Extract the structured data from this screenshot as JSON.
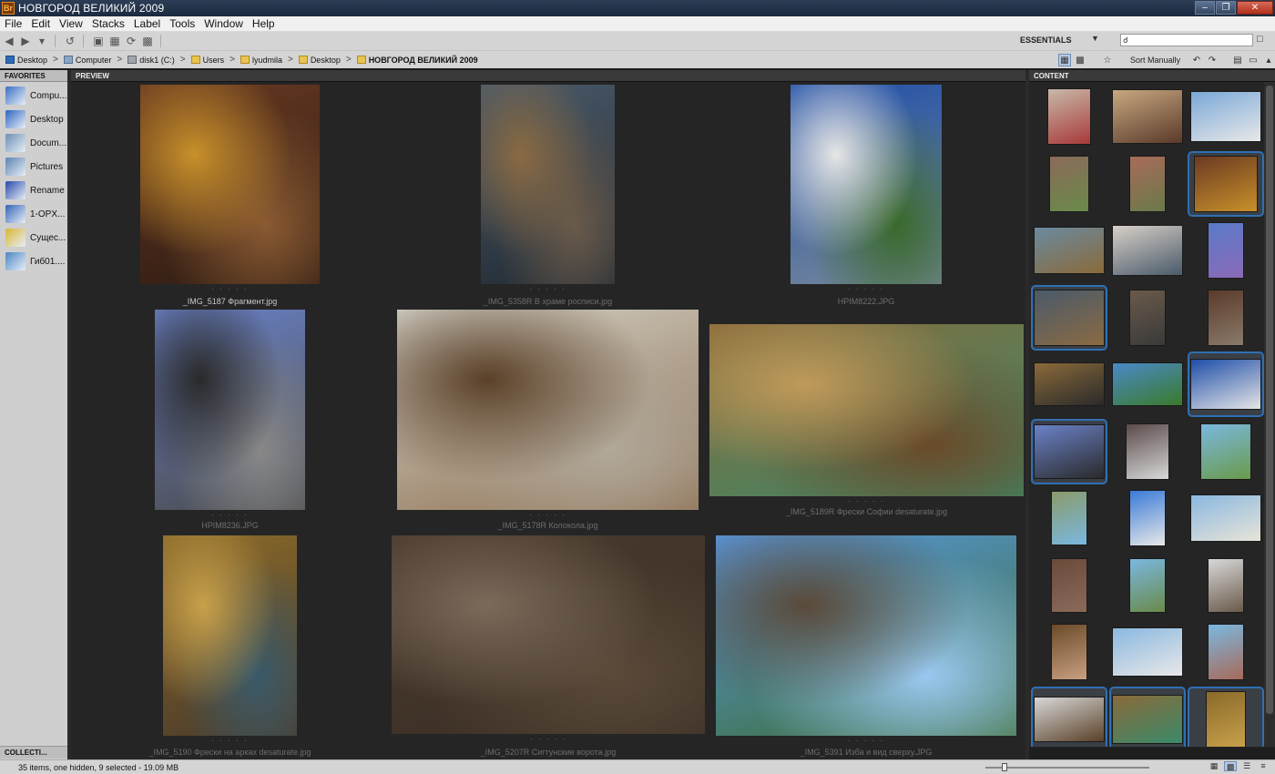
{
  "window": {
    "title": "НОВГОРОД ВЕЛИКИЙ 2009",
    "app_icon": "Br"
  },
  "menu": [
    "File",
    "Edit",
    "View",
    "Stacks",
    "Label",
    "Tools",
    "Window",
    "Help"
  ],
  "toolbar": {
    "workspace": "ESSENTIALS",
    "search_value": ""
  },
  "path": [
    {
      "label": "Desktop",
      "icon": "desk"
    },
    {
      "label": "Computer",
      "icon": "comp"
    },
    {
      "label": "disk1 (C:)",
      "icon": "drive"
    },
    {
      "label": "Users",
      "icon": "folder"
    },
    {
      "label": "lyudmila",
      "icon": "folder"
    },
    {
      "label": "Desktop",
      "icon": "folder"
    },
    {
      "label": "НОВГОРОД ВЕЛИКИЙ 2009",
      "icon": "folder"
    }
  ],
  "sort": "Sort Manually",
  "panels": {
    "favorites": "FAVORITES",
    "collections": "COLLECTI...",
    "preview": "PREVIEW",
    "content": "CONTENT"
  },
  "favorites": [
    {
      "label": "Compu...",
      "color": "#3a6fc4"
    },
    {
      "label": "Desktop",
      "color": "#2d65c0"
    },
    {
      "label": "Docum...",
      "color": "#6a8fb4"
    },
    {
      "label": "Pictures",
      "color": "#5b83b3"
    },
    {
      "label": "Rename",
      "color": "#2649a9"
    },
    {
      "label": "1-OPX...",
      "color": "#3463b8"
    },
    {
      "label": "Сущес...",
      "color": "#d8b534"
    },
    {
      "label": "Гиб01....",
      "color": "#4a86c4"
    }
  ],
  "preview": [
    {
      "caption": "_IMG_5187 Фрагмент.jpg",
      "selected": true,
      "colors": [
        "#6a3a22",
        "#c8902a",
        "#2a1a12",
        "#8a5a32"
      ]
    },
    {
      "caption": "_IMG_5358R В храме росписи.jpg",
      "selected": false,
      "colors": [
        "#4a5a6a",
        "#8a6a42",
        "#222a32",
        "#6a5a4a"
      ]
    },
    {
      "caption": "HPIM8222.JPG",
      "selected": false,
      "colors": [
        "#1e4ea8",
        "#e6e6e6",
        "#7a8a9a",
        "#3a6a2a"
      ]
    },
    {
      "caption": "HPIM8236.JPG",
      "selected": false,
      "colors": [
        "#6a82c8",
        "#2a2a2a",
        "#4a4a4a",
        "#888"
      ]
    },
    {
      "caption": "_IMG_5178R Колокола.jpg",
      "selected": false,
      "colors": [
        "#d8d8d0",
        "#5a4028",
        "#8a6a4a",
        "#b0a89a"
      ]
    },
    {
      "caption": "_IMG_5189R Фрески Софии desaturate.jpg",
      "selected": false,
      "colors": [
        "#8a6a3a",
        "#c09a5a",
        "#3a8a6a",
        "#6a4a2a"
      ]
    },
    {
      "caption": "_IMG_5190 Фрески на арках desaturate.jpg",
      "selected": false,
      "colors": [
        "#8a6a2a",
        "#c8a04a",
        "#4a3a2a",
        "#3a5a6a"
      ]
    },
    {
      "caption": "_IMG_5207R Сигтунские ворота.jpg",
      "selected": false,
      "colors": [
        "#4a3a2e",
        "#7a6a5a",
        "#3a2e24",
        "#5a4a3a"
      ]
    },
    {
      "caption": "_IMG_5391 Изба и вид сверху.JPG",
      "selected": false,
      "colors": [
        "#5a9ae6",
        "#5a4a3a",
        "#3a6a2a",
        "#9ac8f0"
      ]
    }
  ],
  "content": [
    {
      "colors": [
        "#c8b8a8",
        "#a83a3a"
      ],
      "selected": false
    },
    {
      "colors": [
        "#c8a880",
        "#5a3a2a"
      ],
      "selected": false
    },
    {
      "colors": [
        "#7aa8d8",
        "#e8e8e8"
      ],
      "selected": false
    },
    {
      "colors": [
        "#8a6a5a",
        "#6a8a4a"
      ],
      "selected": false
    },
    {
      "colors": [
        "#a86a5a",
        "#6a7a4a"
      ],
      "selected": false
    },
    {
      "colors": [
        "#6a3a22",
        "#c8902a"
      ],
      "selected": true
    },
    {
      "colors": [
        "#6a8aa0",
        "#8a6a3a"
      ],
      "selected": false
    },
    {
      "colors": [
        "#d8d0c8",
        "#4a5a6a"
      ],
      "selected": false
    },
    {
      "colors": [
        "#5a7ac8",
        "#8a6ab8"
      ],
      "selected": false
    },
    {
      "colors": [
        "#4a5a6a",
        "#8a6a42"
      ],
      "selected": true
    },
    {
      "colors": [
        "#6a5a4a",
        "#3a3a3a"
      ],
      "selected": false
    },
    {
      "colors": [
        "#5a3a2a",
        "#8a7a6a"
      ],
      "selected": false
    },
    {
      "colors": [
        "#8a6a3a",
        "#2a2a2a"
      ],
      "selected": false
    },
    {
      "colors": [
        "#4a8ac8",
        "#3a7a2a"
      ],
      "selected": false
    },
    {
      "colors": [
        "#1e4ea8",
        "#e6e6e6"
      ],
      "selected": true
    },
    {
      "colors": [
        "#6a82c8",
        "#2a2a2a"
      ],
      "selected": true
    },
    {
      "colors": [
        "#5a4a4a",
        "#d8d8d8"
      ],
      "selected": false
    },
    {
      "colors": [
        "#7ab8e0",
        "#6a9a4a"
      ],
      "selected": false
    },
    {
      "colors": [
        "#8a9a6a",
        "#7ab8e0"
      ],
      "selected": false
    },
    {
      "colors": [
        "#3a7ad8",
        "#e8e8e8"
      ],
      "selected": false
    },
    {
      "colors": [
        "#8ab8e0",
        "#e8e4d8"
      ],
      "selected": false
    },
    {
      "colors": [
        "#6a4a3a",
        "#8a6a5a"
      ],
      "selected": false
    },
    {
      "colors": [
        "#7ab8e0",
        "#6a8a4a"
      ],
      "selected": false
    },
    {
      "colors": [
        "#d8d8d8",
        "#6a5a4a"
      ],
      "selected": false
    },
    {
      "colors": [
        "#6a4a2a",
        "#c8a080"
      ],
      "selected": false
    },
    {
      "colors": [
        "#8ab8e0",
        "#e8e8e8"
      ],
      "selected": false
    },
    {
      "colors": [
        "#7ab8e0",
        "#a86a5a"
      ],
      "selected": false
    },
    {
      "colors": [
        "#d8d8d8",
        "#5a4028"
      ],
      "selected": true
    },
    {
      "colors": [
        "#8a6a3a",
        "#3a8a6a"
      ],
      "selected": true
    },
    {
      "colors": [
        "#8a6a2a",
        "#c8a04a"
      ],
      "selected": true
    }
  ],
  "status": "35 items, one hidden, 9 selected - 19.09 MB"
}
